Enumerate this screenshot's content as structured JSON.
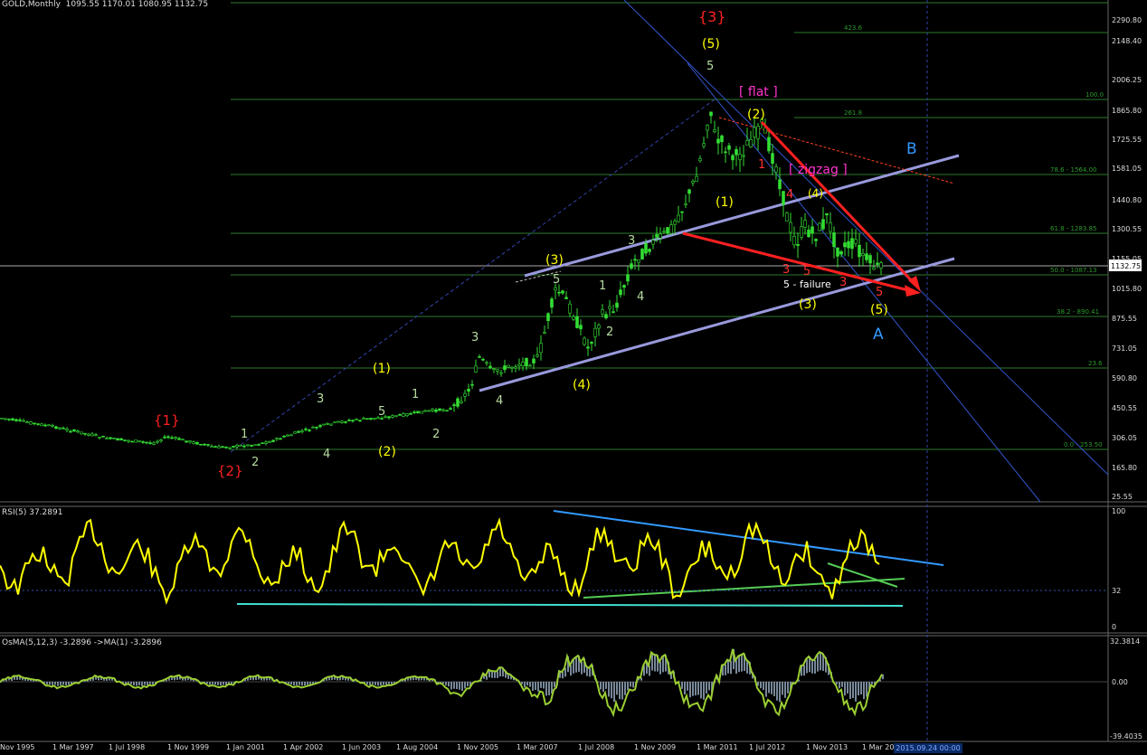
{
  "window": {
    "symbol_label": "GOLD,Monthly",
    "ohlc": "1095.55 1170.01 1080.95 1132.75",
    "current_price_label": "1132.75",
    "rsi_label": "RSI(5) 37.2891",
    "osma_label": "OsMA(5,12,3) -3.2896  ->MA(1) -3.2896",
    "cursor_date_label": "2015.09.24 00:00"
  },
  "price_axis": {
    "ticks": [
      "2290.80",
      "2148.40",
      "2006.25",
      "1865.80",
      "1725.55",
      "1581.05",
      "1440.80",
      "1300.55",
      "1155.05",
      "1015.80",
      "875.55",
      "731.05",
      "590.80",
      "450.55",
      "306.05",
      "165.80",
      "25.55"
    ]
  },
  "rsi_axis": {
    "ticks": [
      "100",
      "32",
      "0"
    ]
  },
  "osma_axis": {
    "ticks": [
      "32.3814",
      "0.00",
      "-39.4035"
    ]
  },
  "time_axis": {
    "labels": [
      "Nov 1995",
      "1 Mar 1997",
      "1 Jul 1998",
      "1 Nov 1999",
      "1 Jan 2001",
      "1 Apr 2002",
      "1 Jun 2003",
      "1 Aug 2004",
      "1 Nov 2005",
      "1 Mar 2007",
      "1 Jul 2008",
      "1 Nov 2009",
      "1 Mar 2011",
      "1 Jul 2012",
      "1 Nov 2013",
      "1 Mar 20"
    ]
  },
  "fib_levels": [
    {
      "label": "0.0 - 253.50"
    },
    {
      "label": "23.6"
    },
    {
      "label": "38.2 - 890.41"
    },
    {
      "label": "50.0 - 1087.13"
    },
    {
      "label": "61.8 - 1283.85"
    },
    {
      "label": "78.6 - 1564.00"
    },
    {
      "label": "100.0"
    },
    {
      "label": "261.8"
    },
    {
      "label": "423.6"
    }
  ],
  "annotations": {
    "red_1": "{1}",
    "red_2": "{2}",
    "red_3": "{3}",
    "flat": "[ flat ]",
    "zigzag": "[ zigzag ]",
    "five_failure": "5 - failure",
    "wave_B": "B",
    "wave_A": "A",
    "y_1": "(1)",
    "y_2": "(2)",
    "y_3": "(3)",
    "y_4": "(4)",
    "y_5": "(5)",
    "y_1b": "(1)",
    "y_2b": "(2)",
    "y_5b": "(5)",
    "y_3b": "(3)",
    "y_4b": "(4)",
    "g_1": "1",
    "g_2": "2",
    "g_3": "3",
    "g_4": "4",
    "g_5": "5",
    "r_3": "3",
    "r_4": "4",
    "r_5": "5",
    "r_1": "1"
  },
  "colors": {
    "candle": "#33dd33",
    "rsi_line": "#ffff00",
    "osma_line": "#9acd32",
    "trend_red": "#ff2020",
    "channel": "#9999dd",
    "fib_line": "#2d7a2d",
    "label_yellow": "#ffff00",
    "label_red": "#ff2020",
    "label_magenta": "#ff33cc",
    "label_cyan": "#3399ff"
  }
}
